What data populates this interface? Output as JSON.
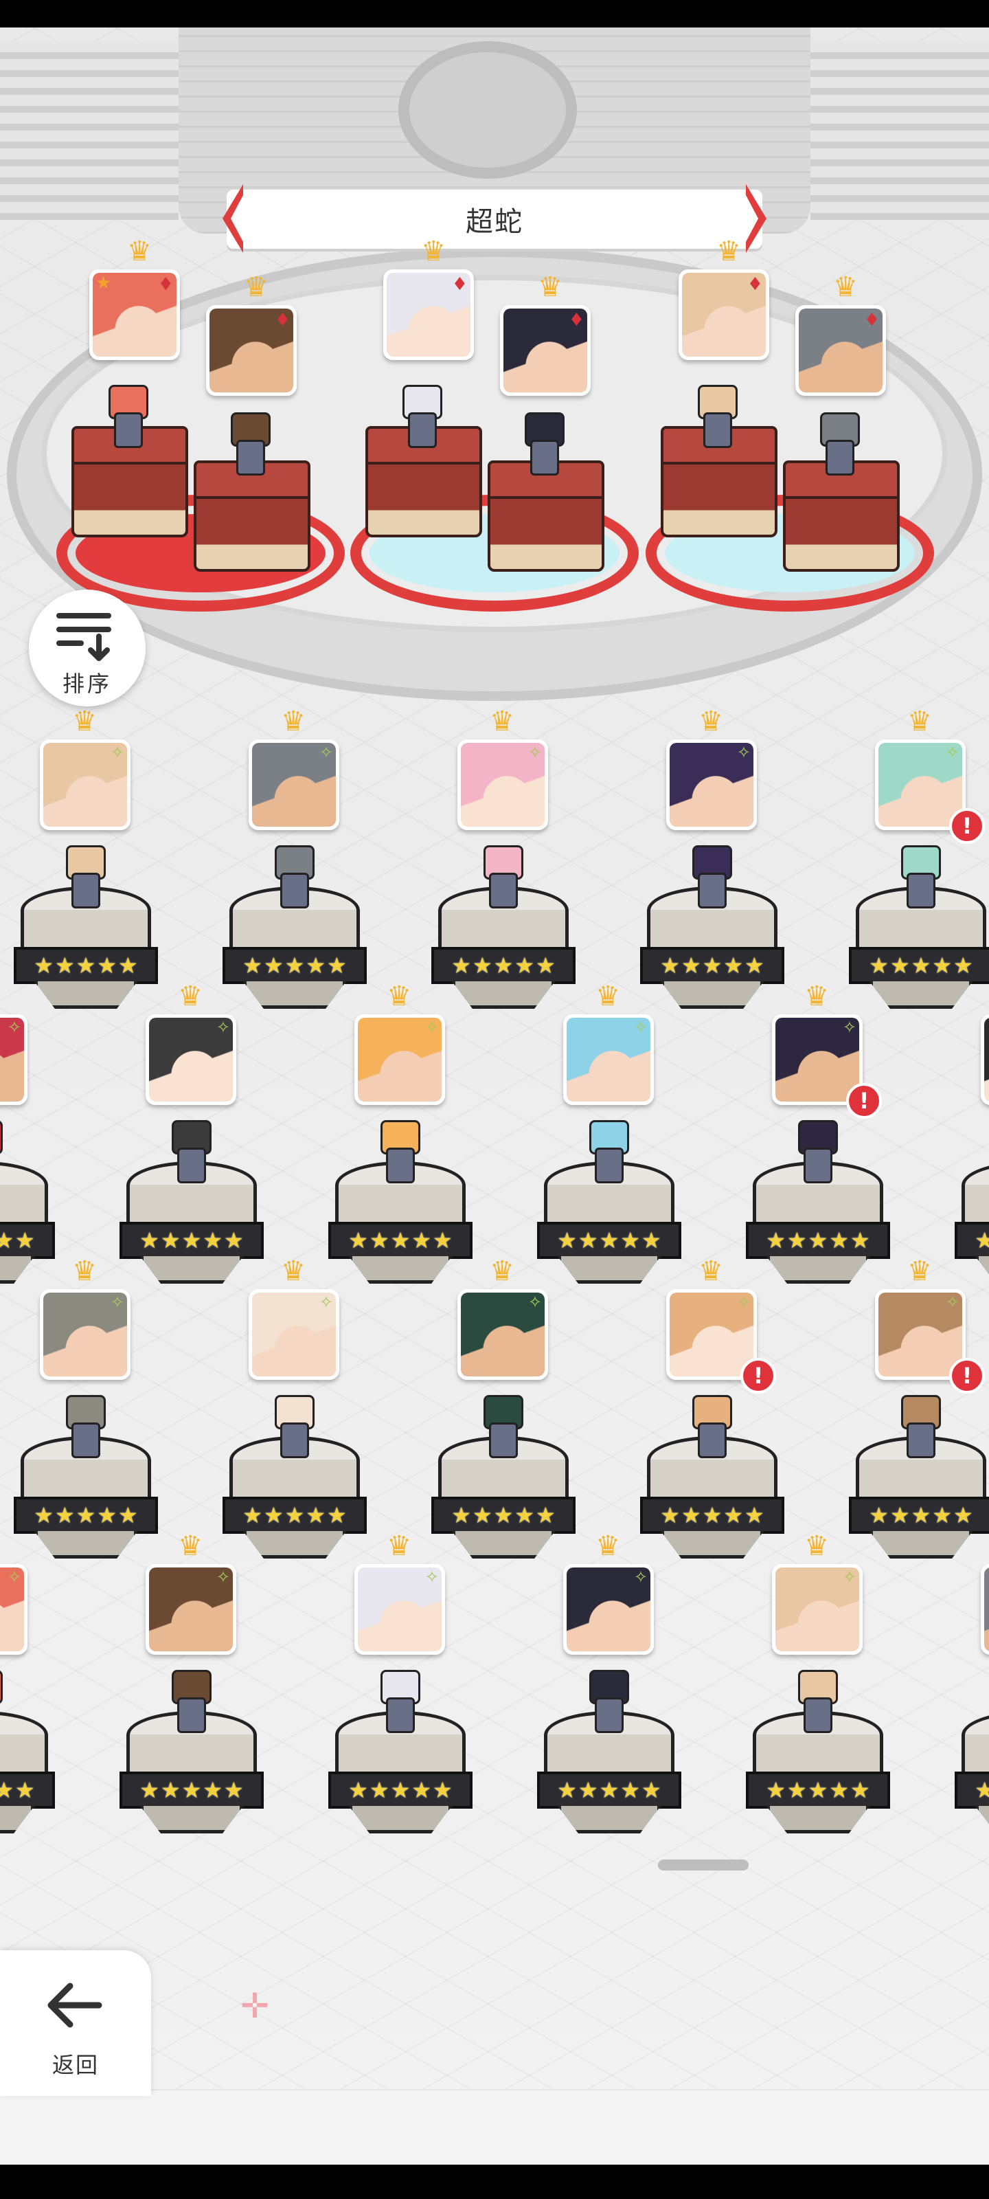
{
  "screen_title": "超蛇",
  "buttons": {
    "sort_label": "排序",
    "back_label": "返回"
  },
  "icons": {
    "sort": "sort-icon",
    "back": "arrow-left-icon",
    "crown": "crown-icon",
    "card_suit": "diamond-suit-icon",
    "new": "sparkle-icon",
    "alert": "exclamation-icon",
    "favorite": "star-icon"
  },
  "colors": {
    "banner_accent": "#e03d3d",
    "crown": "#f3b531",
    "alert": "#e0323b",
    "rating_star": "#f5d13b"
  },
  "team": {
    "groups": [
      {
        "base": "red",
        "heroes": [
          "leader",
          "partner"
        ]
      },
      {
        "base": "light-blue",
        "heroes": [
          "leader",
          "partner"
        ]
      },
      {
        "base": "light-blue",
        "heroes": [
          "leader",
          "partner"
        ]
      }
    ],
    "leader_badge": "★",
    "suit_glyph": "♦"
  },
  "roster": {
    "rating_glyph": "★",
    "rating": 5,
    "alert_glyph": "!",
    "new_glyph": "✧"
  }
}
